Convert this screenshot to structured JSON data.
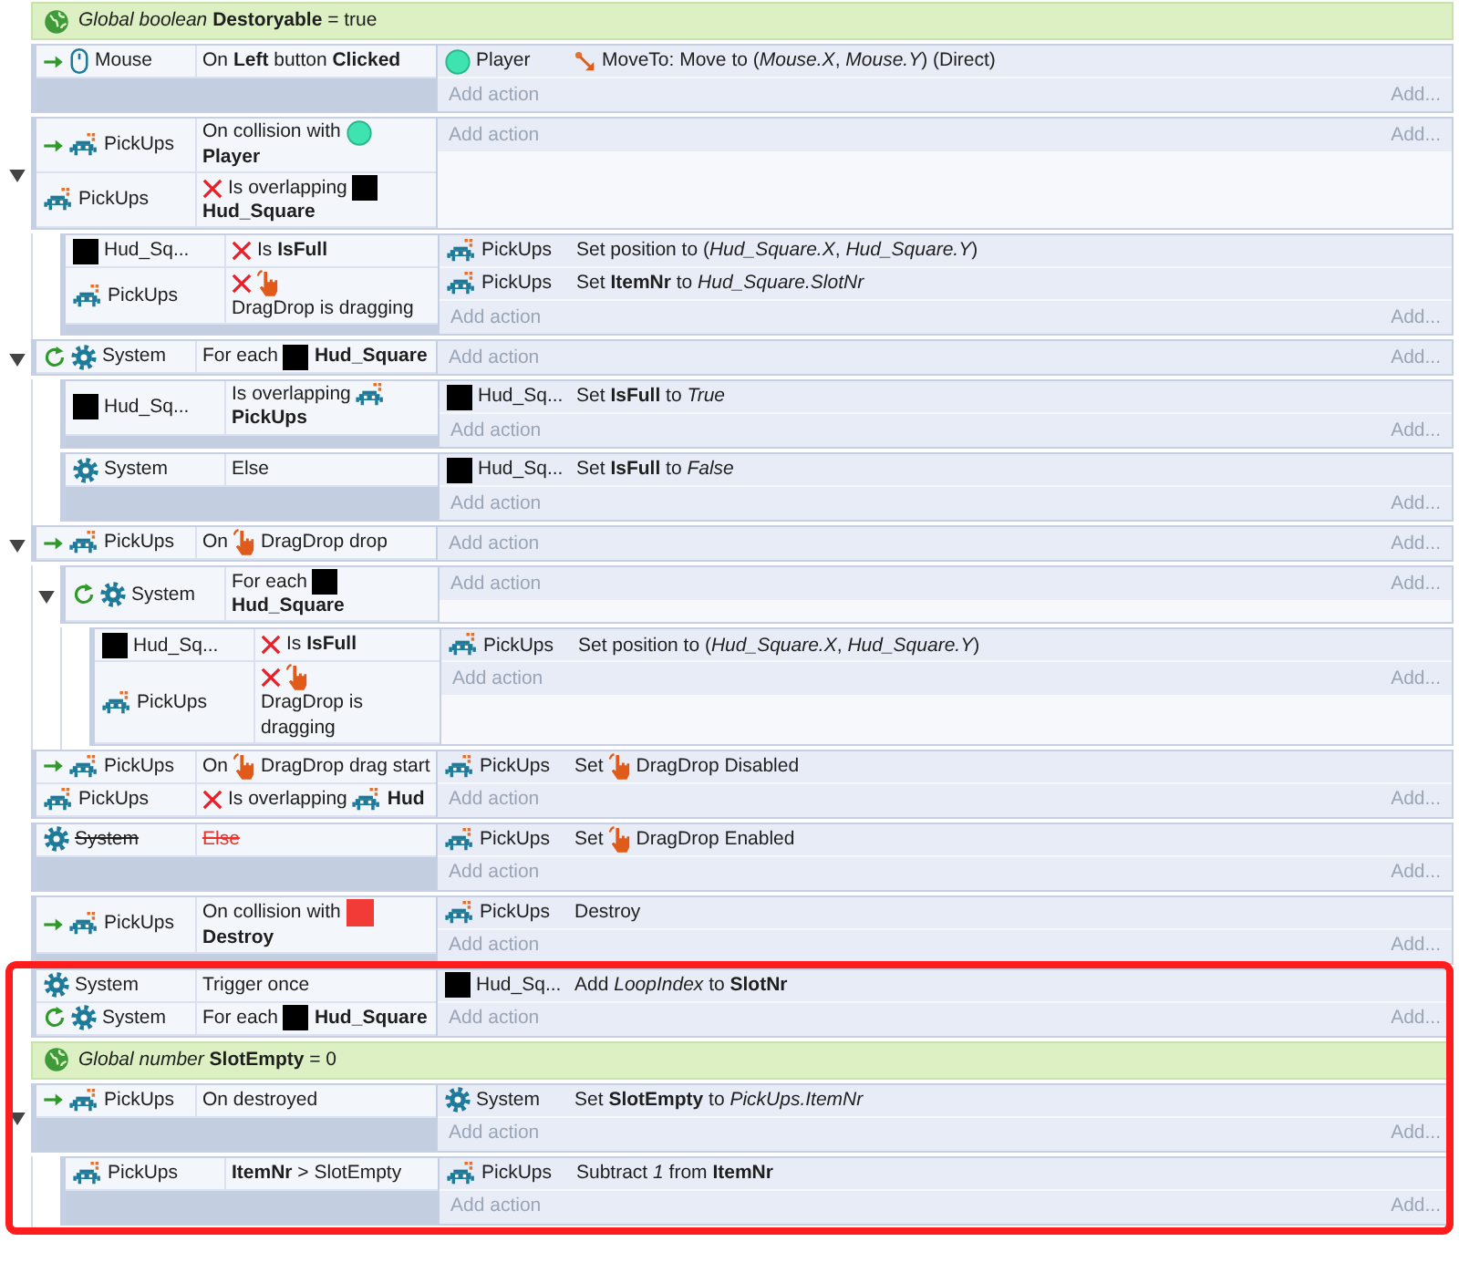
{
  "rows": [
    {
      "kind": "global",
      "text": "*Global boolean* **Destoryable** = true"
    },
    {
      "kind": "event",
      "add_action": "Add action",
      "add_more": "Add...",
      "conditions": [
        {
          "object": {
            "kind": "mouse",
            "name": "Mouse"
          },
          "trigger": true,
          "parts": [
            {
              "kind": "text",
              "text": "On **Left** button **Clicked**"
            }
          ]
        }
      ],
      "actions": [
        {
          "object": {
            "kind": "circle",
            "name": "Player"
          },
          "parts": [
            {
              "kind": "moveto"
            },
            {
              "kind": "text",
              "text": "MoveTo: Move to (*Mouse.X*, *Mouse.Y*) (Direct)"
            }
          ]
        }
      ]
    },
    {
      "kind": "event",
      "expanded": true,
      "add_action": "Add action",
      "add_more": "Add...",
      "conditions": [
        {
          "object": {
            "kind": "sprite",
            "name": "PickUps"
          },
          "trigger": true,
          "parts": [
            {
              "kind": "text",
              "text": "On collision with"
            },
            {
              "kind": "circle"
            },
            {
              "kind": "text",
              "text": "**Player**"
            }
          ]
        },
        {
          "object": {
            "kind": "sprite",
            "name": "PickUps"
          },
          "inverted": true,
          "parts": [
            {
              "kind": "text",
              "text": "Is overlapping"
            },
            {
              "kind": "square"
            },
            {
              "kind": "text",
              "text": "**Hud_Square**"
            }
          ]
        }
      ],
      "children": [
        {
          "kind": "event",
          "add_action": "Add action",
          "add_more": "Add...",
          "conditions": [
            {
              "object": {
                "kind": "square",
                "name": "Hud_Sq..."
              },
              "inverted": true,
              "parts": [
                {
                  "kind": "text",
                  "text": "Is **IsFull**"
                }
              ]
            },
            {
              "object": {
                "kind": "sprite",
                "name": "PickUps"
              },
              "inverted": true,
              "parts": [
                {
                  "kind": "dragdrop"
                },
                {
                  "kind": "text",
                  "text": "DragDrop is dragging"
                }
              ]
            }
          ],
          "actions": [
            {
              "object": {
                "kind": "sprite",
                "name": "PickUps"
              },
              "parts": [
                {
                  "kind": "text",
                  "text": "Set position to (*Hud_Square.X*, *Hud_Square.Y*)"
                }
              ]
            },
            {
              "object": {
                "kind": "sprite",
                "name": "PickUps"
              },
              "parts": [
                {
                  "kind": "text",
                  "text": "Set **ItemNr** to *Hud_Square.SlotNr*"
                }
              ]
            }
          ]
        }
      ]
    },
    {
      "kind": "event",
      "expanded": true,
      "add_action": "Add action",
      "add_more": "Add...",
      "conditions": [
        {
          "object": {
            "kind": "system",
            "name": "System"
          },
          "loop": true,
          "parts": [
            {
              "kind": "text",
              "text": "For each"
            },
            {
              "kind": "square"
            },
            {
              "kind": "text",
              "text": "**Hud_Square**"
            }
          ]
        }
      ],
      "children": [
        {
          "kind": "event",
          "add_action": "Add action",
          "add_more": "Add...",
          "conditions": [
            {
              "object": {
                "kind": "square",
                "name": "Hud_Sq..."
              },
              "parts": [
                {
                  "kind": "text",
                  "text": "Is overlapping"
                },
                {
                  "kind": "sprite"
                },
                {
                  "kind": "text",
                  "text": "**PickUps**"
                }
              ]
            }
          ],
          "actions": [
            {
              "object": {
                "kind": "square",
                "name": "Hud_Sq..."
              },
              "parts": [
                {
                  "kind": "text",
                  "text": "Set **IsFull** to *True*"
                }
              ]
            }
          ]
        },
        {
          "kind": "event",
          "add_action": "Add action",
          "add_more": "Add...",
          "conditions": [
            {
              "object": {
                "kind": "system",
                "name": "System"
              },
              "parts": [
                {
                  "kind": "text",
                  "text": "Else"
                }
              ]
            }
          ],
          "actions": [
            {
              "object": {
                "kind": "square",
                "name": "Hud_Sq..."
              },
              "parts": [
                {
                  "kind": "text",
                  "text": "Set **IsFull** to *False*"
                }
              ]
            }
          ]
        }
      ]
    },
    {
      "kind": "event",
      "expanded": true,
      "add_action": "Add action",
      "add_more": "Add...",
      "conditions": [
        {
          "object": {
            "kind": "sprite",
            "name": "PickUps"
          },
          "trigger": true,
          "parts": [
            {
              "kind": "text",
              "text": "On"
            },
            {
              "kind": "dragdrop"
            },
            {
              "kind": "text",
              "text": "DragDrop drop"
            }
          ]
        }
      ],
      "children": [
        {
          "kind": "event",
          "expanded": true,
          "add_action": "Add action",
          "add_more": "Add...",
          "conditions": [
            {
              "object": {
                "kind": "system",
                "name": "System"
              },
              "loop": true,
              "parts": [
                {
                  "kind": "text",
                  "text": "For each"
                },
                {
                  "kind": "square"
                },
                {
                  "kind": "text",
                  "text": "**Hud_Square**"
                }
              ]
            }
          ],
          "children": [
            {
              "kind": "event",
              "add_action": "Add action",
              "add_more": "Add...",
              "conditions": [
                {
                  "object": {
                    "kind": "square",
                    "name": "Hud_Sq..."
                  },
                  "inverted": true,
                  "parts": [
                    {
                      "kind": "text",
                      "text": "Is **IsFull**"
                    }
                  ]
                },
                {
                  "object": {
                    "kind": "sprite",
                    "name": "PickUps"
                  },
                  "inverted": true,
                  "parts": [
                    {
                      "kind": "dragdrop"
                    },
                    {
                      "kind": "text",
                      "text": "DragDrop is dragging"
                    }
                  ]
                }
              ],
              "actions": [
                {
                  "object": {
                    "kind": "sprite",
                    "name": "PickUps"
                  },
                  "parts": [
                    {
                      "kind": "text",
                      "text": "Set position to (*Hud_Square.X*, *Hud_Square.Y*)"
                    }
                  ]
                }
              ]
            }
          ]
        }
      ]
    },
    {
      "kind": "event",
      "add_action": "Add action",
      "add_more": "Add...",
      "conditions": [
        {
          "object": {
            "kind": "sprite",
            "name": "PickUps"
          },
          "trigger": true,
          "parts": [
            {
              "kind": "text",
              "text": "On"
            },
            {
              "kind": "dragdrop"
            },
            {
              "kind": "text",
              "text": "DragDrop drag start"
            }
          ]
        },
        {
          "object": {
            "kind": "sprite",
            "name": "PickUps"
          },
          "inverted": true,
          "parts": [
            {
              "kind": "text",
              "text": "Is overlapping"
            },
            {
              "kind": "sprite"
            },
            {
              "kind": "text",
              "text": "**Hud**"
            }
          ]
        }
      ],
      "actions": [
        {
          "object": {
            "kind": "sprite",
            "name": "PickUps"
          },
          "parts": [
            {
              "kind": "text",
              "text": "Set"
            },
            {
              "kind": "dragdrop"
            },
            {
              "kind": "text",
              "text": "DragDrop Disabled"
            }
          ]
        }
      ]
    },
    {
      "kind": "event",
      "disabled": true,
      "add_action": "Add action",
      "add_more": "Add...",
      "conditions": [
        {
          "object": {
            "kind": "system",
            "name": "System"
          },
          "invalid": true,
          "parts": [
            {
              "kind": "text",
              "text": "Else"
            }
          ]
        }
      ],
      "actions": [
        {
          "object": {
            "kind": "sprite",
            "name": "PickUps"
          },
          "parts": [
            {
              "kind": "text",
              "text": "Set"
            },
            {
              "kind": "dragdrop"
            },
            {
              "kind": "text",
              "text": "DragDrop Enabled"
            }
          ]
        }
      ]
    },
    {
      "kind": "event",
      "add_action": "Add action",
      "add_more": "Add...",
      "conditions": [
        {
          "object": {
            "kind": "sprite",
            "name": "PickUps"
          },
          "trigger": true,
          "parts": [
            {
              "kind": "text",
              "text": "On collision with"
            },
            {
              "kind": "redsquare"
            },
            {
              "kind": "text",
              "text": "**Destroy**"
            }
          ]
        }
      ],
      "actions": [
        {
          "object": {
            "kind": "sprite",
            "name": "PickUps"
          },
          "parts": [
            {
              "kind": "text",
              "text": "Destroy"
            }
          ]
        }
      ]
    },
    {
      "kind": "event",
      "highlighted": true,
      "add_action": "Add action",
      "add_more": "Add...",
      "conditions": [
        {
          "object": {
            "kind": "system",
            "name": "System"
          },
          "parts": [
            {
              "kind": "text",
              "text": "Trigger once"
            }
          ]
        },
        {
          "object": {
            "kind": "system",
            "name": "System"
          },
          "loop": true,
          "parts": [
            {
              "kind": "text",
              "text": "For each"
            },
            {
              "kind": "square"
            },
            {
              "kind": "text",
              "text": "**Hud_Square**"
            }
          ]
        }
      ],
      "actions": [
        {
          "object": {
            "kind": "square",
            "name": "Hud_Sq..."
          },
          "parts": [
            {
              "kind": "text",
              "text": "Add *LoopIndex* to **SlotNr**"
            }
          ]
        }
      ]
    },
    {
      "kind": "global",
      "highlighted": true,
      "text": "*Global number* **SlotEmpty** = 0"
    },
    {
      "kind": "event",
      "highlighted": true,
      "expanded": true,
      "add_action": "Add action",
      "add_more": "Add...",
      "conditions": [
        {
          "object": {
            "kind": "sprite",
            "name": "PickUps"
          },
          "trigger": true,
          "parts": [
            {
              "kind": "text",
              "text": "On destroyed"
            }
          ]
        }
      ],
      "actions": [
        {
          "object": {
            "kind": "system",
            "name": "System"
          },
          "parts": [
            {
              "kind": "text",
              "text": "Set **SlotEmpty** to *PickUps.ItemNr*"
            }
          ]
        }
      ],
      "children": [
        {
          "kind": "event",
          "add_action": "Add action",
          "add_more": "Add...",
          "conditions": [
            {
              "object": {
                "kind": "sprite",
                "name": "PickUps"
              },
              "parts": [
                {
                  "kind": "text",
                  "text": "**ItemNr** > SlotEmpty"
                }
              ]
            }
          ],
          "actions": [
            {
              "object": {
                "kind": "sprite",
                "name": "PickUps"
              },
              "parts": [
                {
                  "kind": "text",
                  "text": "Subtract *1* from **ItemNr**"
                }
              ]
            }
          ]
        }
      ]
    }
  ]
}
